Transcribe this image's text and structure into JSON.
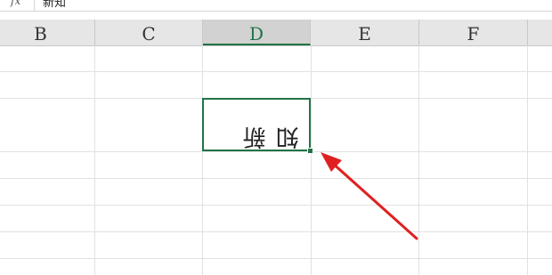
{
  "formula_bar": {
    "fx_label": "fx",
    "value": "新知"
  },
  "columns": [
    {
      "id": "B",
      "label": "B",
      "active": false
    },
    {
      "id": "C",
      "label": "C",
      "active": false
    },
    {
      "id": "D",
      "label": "D",
      "active": true
    },
    {
      "id": "E",
      "label": "E",
      "active": false
    },
    {
      "id": "F",
      "label": "F",
      "active": false
    }
  ],
  "selected_cell": {
    "column": "D",
    "text": "新知"
  },
  "colors": {
    "accent": "#217346",
    "annotation_arrow": "#e02020"
  }
}
